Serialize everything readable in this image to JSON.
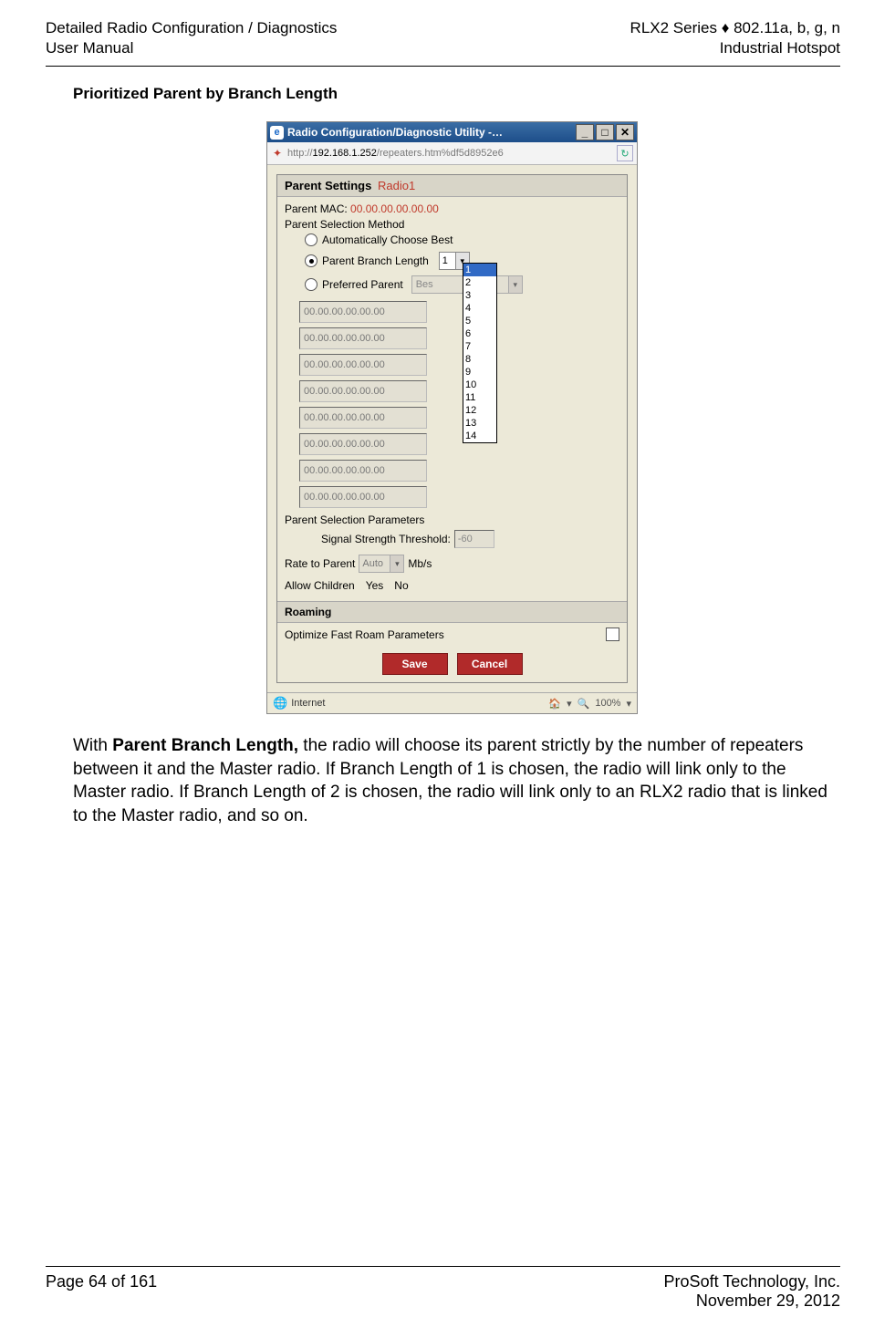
{
  "header": {
    "left1": "Detailed Radio Configuration / Diagnostics",
    "left2": "User Manual",
    "right1": "RLX2 Series ♦ 802.11a, b, g, n",
    "right2": "Industrial Hotspot"
  },
  "section_title": "Prioritized Parent by Branch Length",
  "screen": {
    "window_title": "Radio Configuration/Diagnostic Utility -…",
    "url_prefix": "http://",
    "url_host": "192.168.1.252",
    "url_path": "/repeaters.htm%df5d8952e6",
    "panel1_title": "Parent Settings",
    "radio_name": "Radio1",
    "parent_mac_label": "Parent MAC:",
    "parent_mac_value": "00.00.00.00.00.00",
    "method_label": "Parent Selection Method",
    "opt_auto": "Automatically Choose Best",
    "opt_branch": "Parent Branch Length",
    "branch_value": "1",
    "branch_options": [
      "1",
      "2",
      "3",
      "4",
      "5",
      "6",
      "7",
      "8",
      "9",
      "10",
      "11",
      "12",
      "13",
      "14"
    ],
    "opt_preferred": "Preferred Parent",
    "preferred_value": "Bes",
    "mac_inputs": [
      "00.00.00.00.00.00",
      "00.00.00.00.00.00",
      "00.00.00.00.00.00",
      "00.00.00.00.00.00",
      "00.00.00.00.00.00",
      "00.00.00.00.00.00",
      "00.00.00.00.00.00",
      "00.00.00.00.00.00"
    ],
    "params_label": "Parent Selection Parameters",
    "signal_label": "Signal Strength Threshold:",
    "signal_value": "-60",
    "rate_label": "Rate to Parent",
    "rate_value": "Auto",
    "rate_unit": "Mb/s",
    "allow_label": "Allow Children",
    "allow_yes": "Yes",
    "allow_no": "No",
    "roaming_title": "Roaming",
    "roaming_opt": "Optimize Fast Roam Parameters",
    "save_btn": "Save",
    "cancel_btn": "Cancel",
    "status_internet": "Internet",
    "status_zoom": "100%"
  },
  "body_html_prefix": "With ",
  "body_bold": "Parent Branch Length,",
  "body_rest": " the radio will choose its parent strictly by the number of repeaters between it and the Master radio. If Branch Length of 1 is chosen, the radio will link only to the Master radio. If Branch Length of 2 is chosen, the radio will link only to an RLX2 radio that is linked to the Master radio, and so on.",
  "footer": {
    "left": "Page 64 of 161",
    "right1": "ProSoft Technology, Inc.",
    "right2": "November 29, 2012"
  }
}
